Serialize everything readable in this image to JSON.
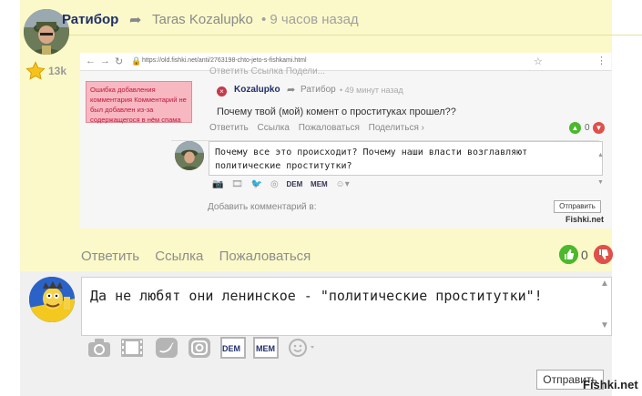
{
  "comment": {
    "author": "Ратибор",
    "reply_to": "Taras Kozalupko",
    "time": "• 9 часов назад",
    "rating": "13k",
    "actions": [
      "Ответить",
      "Ссылка",
      "Пожаловаться"
    ],
    "votes": "0"
  },
  "screenshot": {
    "url": "https://old.fishki.net/anti/2763198-chto-jeto-s-fishkami.html",
    "ghost_text": "Ответить   Ссылка   Подели...",
    "error_text": "Ошибка добавления комментария Комментарий не был добавлен из-за содержащегося в нём спама",
    "author": "Kozalupko",
    "reply_to": "Ратибор",
    "time": "• 49 минут назад",
    "question": "Почему твой (мой) комент о проституках прошел??",
    "actions": [
      "Ответить",
      "Ссылка",
      "Пожаловаться",
      "Поделиться ›"
    ],
    "votes": "0",
    "reply_text": "Почему все это происходит? Почему наши власти возглавляют политические проститутки?",
    "tools": [
      "DEM",
      "МЕМ"
    ],
    "add_label": "Добавить комментарий в:",
    "send_label": "Отправить",
    "watermark": "Fishki.net"
  },
  "form": {
    "text": "Да не любят они ленинское - \"политические проститутки\"!",
    "tools": [
      "DEM",
      "МЕМ"
    ],
    "send_label": "Отправить",
    "watermark": "Fishki.net"
  },
  "colors": {
    "card_bg": "#fbf9c9",
    "author": "#1f2f6b",
    "vote_up": "#4cb82d",
    "vote_down": "#e0504a"
  }
}
